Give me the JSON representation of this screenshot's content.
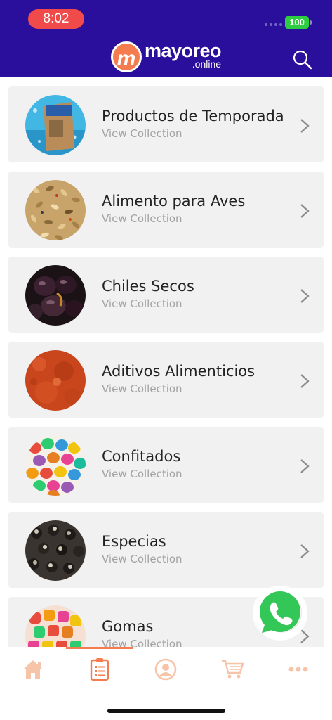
{
  "status_bar": {
    "time": "8:02",
    "battery": "100"
  },
  "header": {
    "logo_mark": "m",
    "logo_word": "mayoreo",
    "logo_sub": ".online"
  },
  "colors": {
    "header_bg": "#2a0f9c",
    "accent": "#f47c4e",
    "card_bg": "#f1f1f1",
    "whatsapp": "#2ecc40"
  },
  "collections": [
    {
      "title": "Productos de Temporada",
      "subtitle": "View Collection",
      "image": "seasonal-product-bag"
    },
    {
      "title": "Alimento para Aves",
      "subtitle": "View Collection",
      "image": "bird-seed"
    },
    {
      "title": "Chiles Secos",
      "subtitle": "View Collection",
      "image": "dried-chiles"
    },
    {
      "title": "Aditivos Alimenticios",
      "subtitle": "View Collection",
      "image": "red-powder"
    },
    {
      "title": "Confitados",
      "subtitle": "View Collection",
      "image": "candy-coated-chocolates"
    },
    {
      "title": "Especias",
      "subtitle": "View Collection",
      "image": "dark-spices"
    },
    {
      "title": "Gomas",
      "subtitle": "View Collection",
      "image": "gummy-candies"
    }
  ],
  "tabs": [
    {
      "name": "home",
      "icon": "home-icon"
    },
    {
      "name": "collections",
      "icon": "clipboard-list-icon",
      "active": true
    },
    {
      "name": "account",
      "icon": "user-icon"
    },
    {
      "name": "cart",
      "icon": "cart-icon"
    },
    {
      "name": "more",
      "icon": "more-dots-icon"
    }
  ]
}
